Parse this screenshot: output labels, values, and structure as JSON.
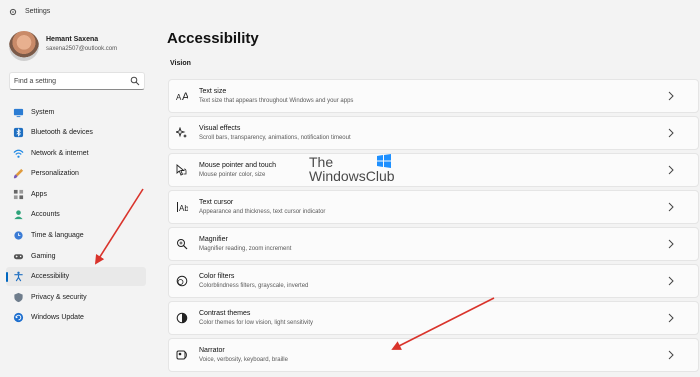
{
  "window": {
    "title": "Settings"
  },
  "account": {
    "name": "Hemant Saxena",
    "email": "saxena2507@outlook.com"
  },
  "search": {
    "placeholder": "Find a setting"
  },
  "sidebar": {
    "items": [
      {
        "label": "System",
        "icon": "monitor-icon"
      },
      {
        "label": "Bluetooth & devices",
        "icon": "bluetooth-icon"
      },
      {
        "label": "Network & internet",
        "icon": "wifi-icon"
      },
      {
        "label": "Personalization",
        "icon": "brush-icon"
      },
      {
        "label": "Apps",
        "icon": "apps-icon"
      },
      {
        "label": "Accounts",
        "icon": "person-icon"
      },
      {
        "label": "Time & language",
        "icon": "globe-clock-icon"
      },
      {
        "label": "Gaming",
        "icon": "gamepad-icon"
      },
      {
        "label": "Accessibility",
        "icon": "accessibility-icon",
        "selected": true
      },
      {
        "label": "Privacy & security",
        "icon": "shield-icon"
      },
      {
        "label": "Windows Update",
        "icon": "update-icon"
      }
    ]
  },
  "main": {
    "title": "Accessibility",
    "section": "Vision",
    "cards": [
      {
        "title": "Text size",
        "desc": "Text size that appears throughout Windows and your apps",
        "icon": "text-size-icon"
      },
      {
        "title": "Visual effects",
        "desc": "Scroll bars, transparency, animations, notification timeout",
        "icon": "sparkle-icon"
      },
      {
        "title": "Mouse pointer and touch",
        "desc": "Mouse pointer color, size",
        "icon": "pointer-icon"
      },
      {
        "title": "Text cursor",
        "desc": "Appearance and thickness, text cursor indicator",
        "icon": "text-cursor-icon"
      },
      {
        "title": "Magnifier",
        "desc": "Magnifier reading, zoom increment",
        "icon": "magnifier-icon"
      },
      {
        "title": "Color filters",
        "desc": "Colorblindness filters, grayscale, inverted",
        "icon": "color-filter-icon"
      },
      {
        "title": "Contrast themes",
        "desc": "Color themes for low vision, light sensitivity",
        "icon": "contrast-icon"
      },
      {
        "title": "Narrator",
        "desc": "Voice, verbosity, keyboard, braille",
        "icon": "narrator-icon"
      }
    ]
  },
  "watermark": {
    "line1": "The",
    "line2": "WindowsClub"
  },
  "colors": {
    "accent": "#0067c0",
    "arrow": "#d9332b",
    "background": "#f3f3f3",
    "card": "#fbfbfb"
  }
}
